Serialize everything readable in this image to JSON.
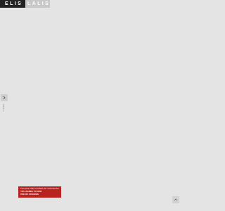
{
  "header": {
    "logo_primary": "ELIS",
    "logo_secondary": "LALIS"
  },
  "sidebar": {
    "toggle_icon": "chevron-right-icon",
    "label": "MENU"
  },
  "cookie_banner": {
    "text": "THIS SITE USES COOKIES. BY CONTINUING TO BROWSE",
    "link_line_1": "YOU AGREE TO OUR",
    "link_line_2": "USE OF COOKIES"
  },
  "scroll_top": {
    "icon": "chevron-up-icon"
  },
  "colors": {
    "background": "#e4e4e4",
    "logo_dark": "#222222",
    "logo_light": "#c8c8c8",
    "banner": "#b8231f"
  }
}
